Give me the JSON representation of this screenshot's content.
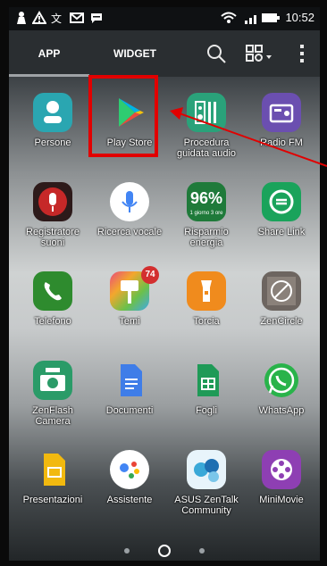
{
  "status_bar": {
    "time": "10:52",
    "left_icons": [
      "person-icon",
      "warning-icon",
      "translate-icon",
      "gmail-icon",
      "chat-icon"
    ],
    "right_icons": [
      "wifi-icon",
      "signal-icon",
      "battery-icon"
    ]
  },
  "tabs": {
    "app_label": "APP",
    "widget_label": "WIDGET",
    "active": "APP"
  },
  "top_actions": [
    "search-icon",
    "view-options-icon",
    "more-vert-icon"
  ],
  "apps": [
    {
      "label": "Persone",
      "icon": "contacts-icon",
      "color": "#2aa6b1"
    },
    {
      "label": "Play Store",
      "icon": "play-store-icon",
      "color": "#ffffff"
    },
    {
      "label": "Procedura guidata audio",
      "icon": "audio-wizard-icon",
      "color": "#2aa27a"
    },
    {
      "label": "Radio FM",
      "icon": "radio-icon",
      "color": "#6b4fb0"
    },
    {
      "label": "Registratore suoni",
      "icon": "mic-icon",
      "color": "#8a1f1f"
    },
    {
      "label": "Ricerca vocale",
      "icon": "voice-search-icon",
      "color": "#ffffff"
    },
    {
      "label": "Risparmio energia",
      "icon": "power-saver-icon",
      "color": "#1f7a3a",
      "icon_text": "96%",
      "icon_subtext": "1 giorno 3 ore"
    },
    {
      "label": "Share Link",
      "icon": "share-link-icon",
      "color": "#1aa35b"
    },
    {
      "label": "Telefono",
      "icon": "phone-icon",
      "color": "#2e8b2e"
    },
    {
      "label": "Temi",
      "icon": "themes-icon",
      "color": "#f3a72d",
      "badge": "74"
    },
    {
      "label": "Torcia",
      "icon": "flashlight-icon",
      "color": "#f08b1d"
    },
    {
      "label": "ZenCircle",
      "icon": "zencircle-icon",
      "color": "#6d6560"
    },
    {
      "label": "ZenFlash Camera",
      "icon": "camera-flash-icon",
      "color": "#2a9b68"
    },
    {
      "label": "Documenti",
      "icon": "docs-icon",
      "color": "#3f7de8"
    },
    {
      "label": "Fogli",
      "icon": "sheets-icon",
      "color": "#1f9a57"
    },
    {
      "label": "WhatsApp",
      "icon": "whatsapp-icon",
      "color": "#29b34a"
    },
    {
      "label": "Presentazioni",
      "icon": "slides-icon",
      "color": "#f2b90f"
    },
    {
      "label": "Assistente",
      "icon": "assistant-icon",
      "color": "#ffffff"
    },
    {
      "label": "ASUS ZenTalk Community",
      "icon": "zentalk-icon",
      "color": "#3aa8d8"
    },
    {
      "label": "MiniMovie",
      "icon": "minimovie-icon",
      "color": "#8e3fb3"
    }
  ],
  "annotation": {
    "highlight": "Play Store"
  },
  "pager": {
    "pages": 3,
    "current": "home"
  }
}
